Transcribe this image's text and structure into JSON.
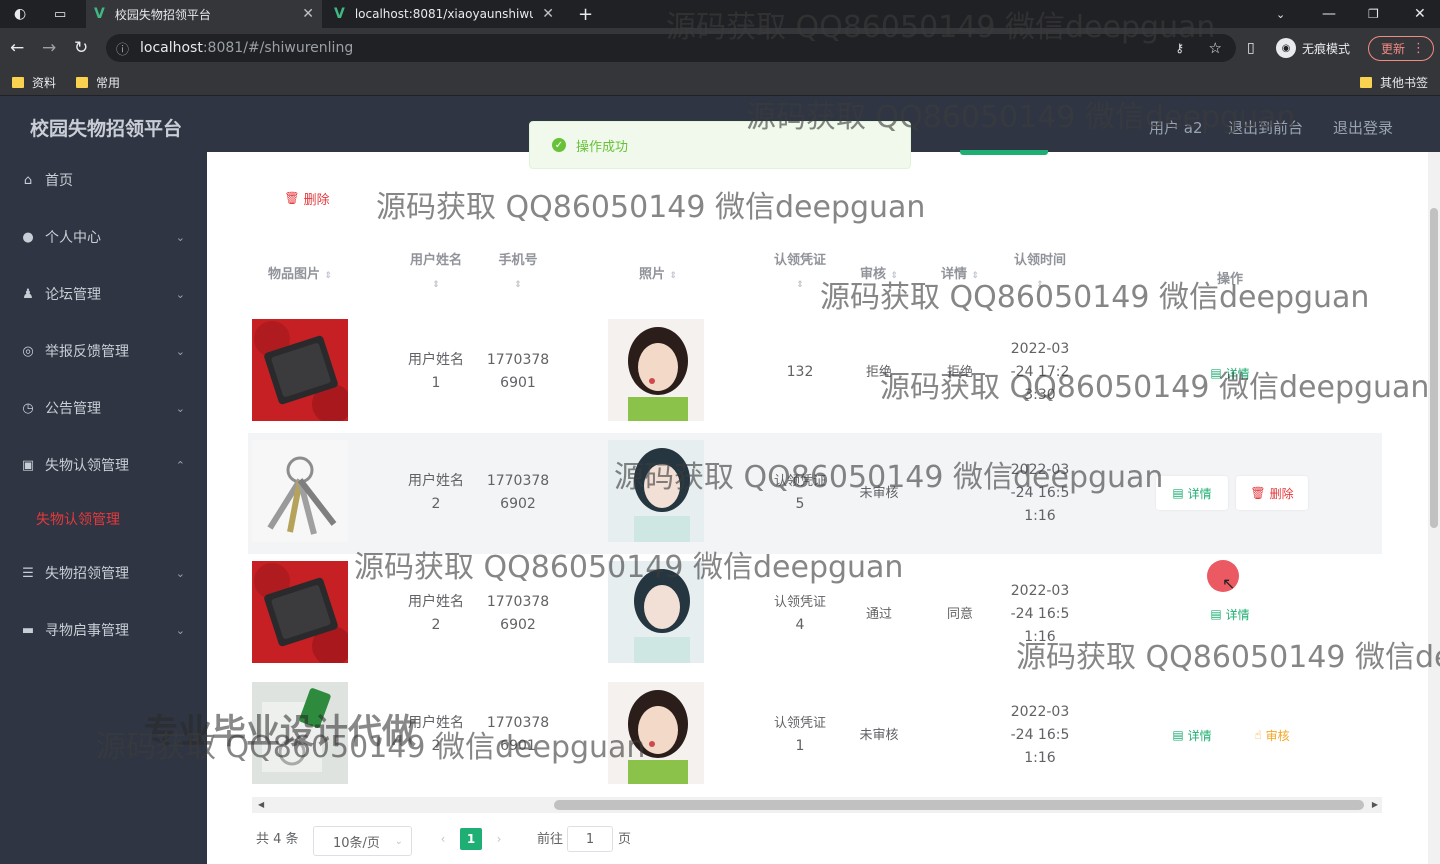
{
  "browser": {
    "tabs": [
      {
        "title": "校园失物招领平台",
        "active": true
      },
      {
        "title": "localhost:8081/xiaoyaunshiwu",
        "active": false
      }
    ],
    "url_host": "localhost",
    "url_path": ":8081/#/shiwurenling",
    "incognito_label": "无痕模式",
    "update_label": "更新",
    "bookmarks": [
      "资料",
      "常用"
    ],
    "other_bookmarks": "其他书签"
  },
  "header": {
    "app_title": "校园失物招领平台",
    "user_label": "用户 a2",
    "back_front_label": "退出到前台",
    "logout_label": "退出登录"
  },
  "toast": {
    "message": "操作成功"
  },
  "sidebar": {
    "items": [
      {
        "label": "首页",
        "icon": "home-icon"
      },
      {
        "label": "个人中心",
        "icon": "user-icon"
      },
      {
        "label": "论坛管理",
        "icon": "user-icon"
      },
      {
        "label": "举报反馈管理",
        "icon": "circle-icon"
      },
      {
        "label": "公告管理",
        "icon": "clock-icon"
      },
      {
        "label": "失物认领管理",
        "icon": "board-icon"
      },
      {
        "label": "失物招领管理",
        "icon": "list-icon"
      },
      {
        "label": "寻物启事管理",
        "icon": "card-icon"
      }
    ],
    "active_sub": "失物认领管理"
  },
  "toolbar": {
    "delete_label": "删除"
  },
  "table": {
    "headers": {
      "image": "物品图片",
      "user_name": "用户姓名",
      "phone": "手机号",
      "photo": "照片",
      "voucher": "认领凭证",
      "audit": "审核",
      "detail": "详情",
      "claim_time": "认领时间",
      "operation": "操作"
    },
    "rows": [
      {
        "item": "wallet",
        "user_name": [
          "用户姓名",
          "1"
        ],
        "phone": [
          "1770378",
          "6901"
        ],
        "photo": "portrait-a",
        "voucher": [
          "132"
        ],
        "audit": "拒绝",
        "detail": "拒绝",
        "time": [
          "2022-03",
          "-24 17:2",
          "3:30"
        ],
        "ops": [
          "详情"
        ]
      },
      {
        "item": "keys",
        "user_name": [
          "用户姓名",
          "2"
        ],
        "phone": [
          "1770378",
          "6902"
        ],
        "photo": "portrait-b",
        "voucher": [
          "认领凭证",
          "5"
        ],
        "audit": "未审核",
        "detail": "",
        "time": [
          "2022-03",
          "-24 16:5",
          "1:16"
        ],
        "ops": [
          "详情",
          "删除"
        ]
      },
      {
        "item": "wallet",
        "user_name": [
          "用户姓名",
          "2"
        ],
        "phone": [
          "1770378",
          "6902"
        ],
        "photo": "portrait-b",
        "voucher": [
          "认领凭证",
          "4"
        ],
        "audit": "通过",
        "detail": "同意",
        "time": [
          "2022-03",
          "-24 16:5",
          "1:16"
        ],
        "ops": [
          "详情"
        ]
      },
      {
        "item": "tag",
        "user_name": [
          "用户姓名",
          "2"
        ],
        "phone": [
          "1770378",
          "6901"
        ],
        "photo": "portrait-a",
        "voucher": [
          "认领凭证",
          "1"
        ],
        "audit": "未审核",
        "detail": "",
        "time": [
          "2022-03",
          "-24 16:5",
          "1:16"
        ],
        "ops": [
          "详情",
          "审核"
        ]
      }
    ]
  },
  "pagination": {
    "total": "共 4 条",
    "page_size": "10条/页",
    "current": "1",
    "goto_label": "前往",
    "goto_value": "1",
    "page_unit": "页"
  },
  "watermark": {
    "text": "源码获取 QQ86050149 微信deepguan",
    "text_cut": "源码获取 QQ86050149 微信de",
    "banner": "专业毕业设计代做"
  },
  "colors": {
    "sidebar_bg": "#2f3542",
    "accent_green": "#1fae73",
    "danger": "#e4393c",
    "warning": "#f5a623"
  }
}
